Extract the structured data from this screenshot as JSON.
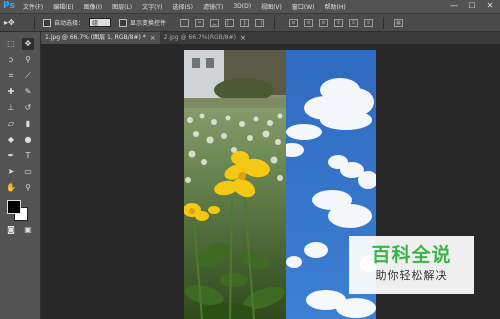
{
  "app": {
    "logo": "Ps"
  },
  "menu": [
    {
      "label": "文件(F)"
    },
    {
      "label": "编辑(E)"
    },
    {
      "label": "图像(I)"
    },
    {
      "label": "图层(L)"
    },
    {
      "label": "文字(Y)"
    },
    {
      "label": "选择(S)"
    },
    {
      "label": "滤镜(T)"
    },
    {
      "label": "3D(D)"
    },
    {
      "label": "视图(V)"
    },
    {
      "label": "窗口(W)"
    },
    {
      "label": "帮助(H)"
    }
  ],
  "window_controls": {
    "minimize": "—",
    "maximize": "☐",
    "close": "✕"
  },
  "options_bar": {
    "auto_select_label": "自动选择：",
    "auto_select_value": "组",
    "show_transform_label": "显示变换控件"
  },
  "tabs": [
    {
      "label": "1.jpg @ 66.7% (图层 1, RGB/8#) *",
      "close": "×"
    },
    {
      "label": "2.jpg @ 66.7%(RGB/8#)",
      "close": "×"
    }
  ],
  "watermark": {
    "title": "百科全说",
    "subtitle": "助你轻松解决"
  },
  "colors": {
    "foreground": "#000000",
    "background": "#ffffff",
    "brand_green": "#3bb54a",
    "ps_blue": "#31a8ff"
  },
  "tools": [
    [
      "marquee-icon",
      "move-icon"
    ],
    [
      "lasso-icon",
      "magic-wand-icon"
    ],
    [
      "crop-icon",
      "eyedropper-icon"
    ],
    [
      "healing-icon",
      "brush-icon"
    ],
    [
      "stamp-icon",
      "history-brush-icon"
    ],
    [
      "eraser-icon",
      "gradient-icon"
    ],
    [
      "blur-icon",
      "dodge-icon"
    ],
    [
      "pen-icon",
      "type-icon"
    ],
    [
      "path-select-icon",
      "shape-icon"
    ],
    [
      "hand-icon",
      "zoom-icon"
    ]
  ]
}
